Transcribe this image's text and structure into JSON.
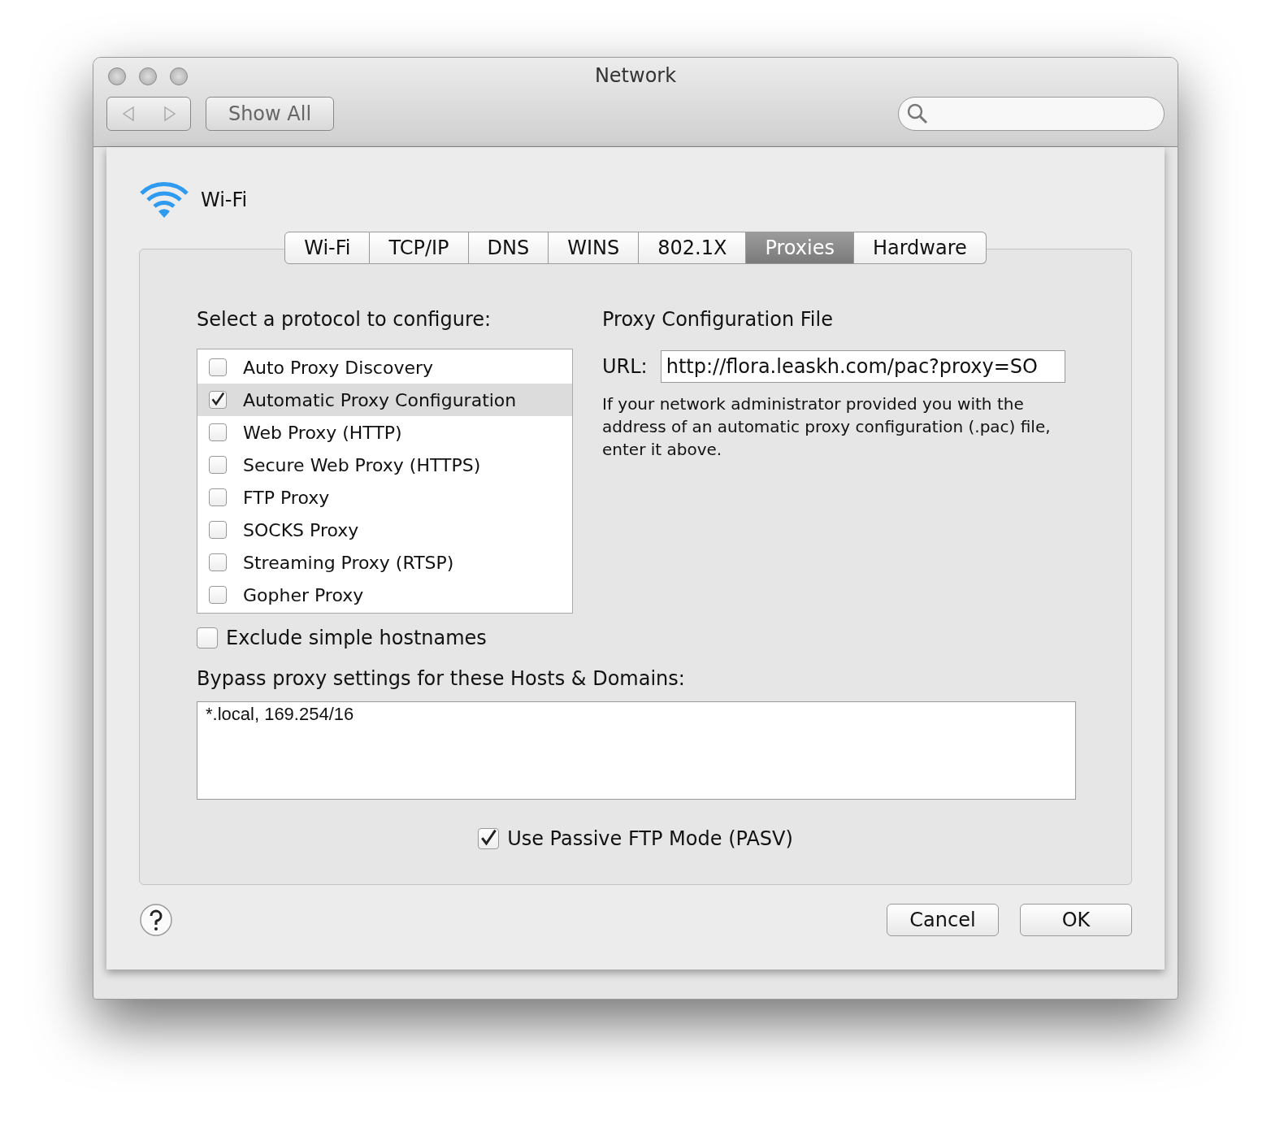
{
  "window": {
    "title": "Network"
  },
  "toolbar": {
    "show_all": "Show All"
  },
  "sheet": {
    "service": "Wi-Fi",
    "tabs": [
      {
        "label": "Wi-Fi",
        "selected": false
      },
      {
        "label": "TCP/IP",
        "selected": false
      },
      {
        "label": "DNS",
        "selected": false
      },
      {
        "label": "WINS",
        "selected": false
      },
      {
        "label": "802.1X",
        "selected": false
      },
      {
        "label": "Proxies",
        "selected": true
      },
      {
        "label": "Hardware",
        "selected": false
      }
    ],
    "protocols_label": "Select a protocol to configure:",
    "protocols": [
      {
        "label": "Auto Proxy Discovery",
        "checked": false,
        "selected": false
      },
      {
        "label": "Automatic Proxy Configuration",
        "checked": true,
        "selected": true
      },
      {
        "label": "Web Proxy (HTTP)",
        "checked": false,
        "selected": false
      },
      {
        "label": "Secure Web Proxy (HTTPS)",
        "checked": false,
        "selected": false
      },
      {
        "label": "FTP Proxy",
        "checked": false,
        "selected": false
      },
      {
        "label": "SOCKS Proxy",
        "checked": false,
        "selected": false
      },
      {
        "label": "Streaming Proxy (RTSP)",
        "checked": false,
        "selected": false
      },
      {
        "label": "Gopher Proxy",
        "checked": false,
        "selected": false
      }
    ],
    "config_title": "Proxy Configuration File",
    "url_label": "URL:",
    "url_value": "http://flora.leaskh.com/pac?proxy=SO",
    "help_text": "If your network administrator provided you with the address of an automatic proxy configuration (.pac) file, enter it above.",
    "exclude_simple_hostnames": {
      "label": "Exclude simple hostnames",
      "checked": false
    },
    "bypass_label": "Bypass proxy settings for these Hosts & Domains:",
    "bypass_value": "*.local, 169.254/16",
    "passive_ftp": {
      "label": "Use Passive FTP Mode (PASV)",
      "checked": true
    },
    "buttons": [
      {
        "label": "Cancel"
      },
      {
        "label": "OK"
      }
    ]
  }
}
